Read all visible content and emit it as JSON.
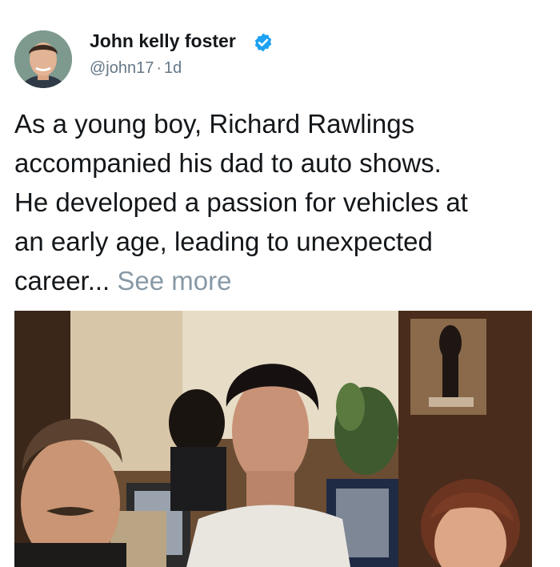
{
  "post": {
    "author": {
      "name": "John kelly foster",
      "handle": "@john17",
      "time": "1d",
      "avatar_icon": "person-avatar",
      "verified_icon": "verified-badge-icon",
      "verified_color": "#1da1f2"
    },
    "text": {
      "lines": [
        "As a young boy, Richard Rawlings",
        "accompanied his dad to auto shows.",
        "He developed a passion for vehicles at",
        "an early age, leading to unexpected"
      ],
      "last_line": "career...",
      "see_more": "See more"
    },
    "photo": {
      "subject": "family-photo"
    }
  }
}
